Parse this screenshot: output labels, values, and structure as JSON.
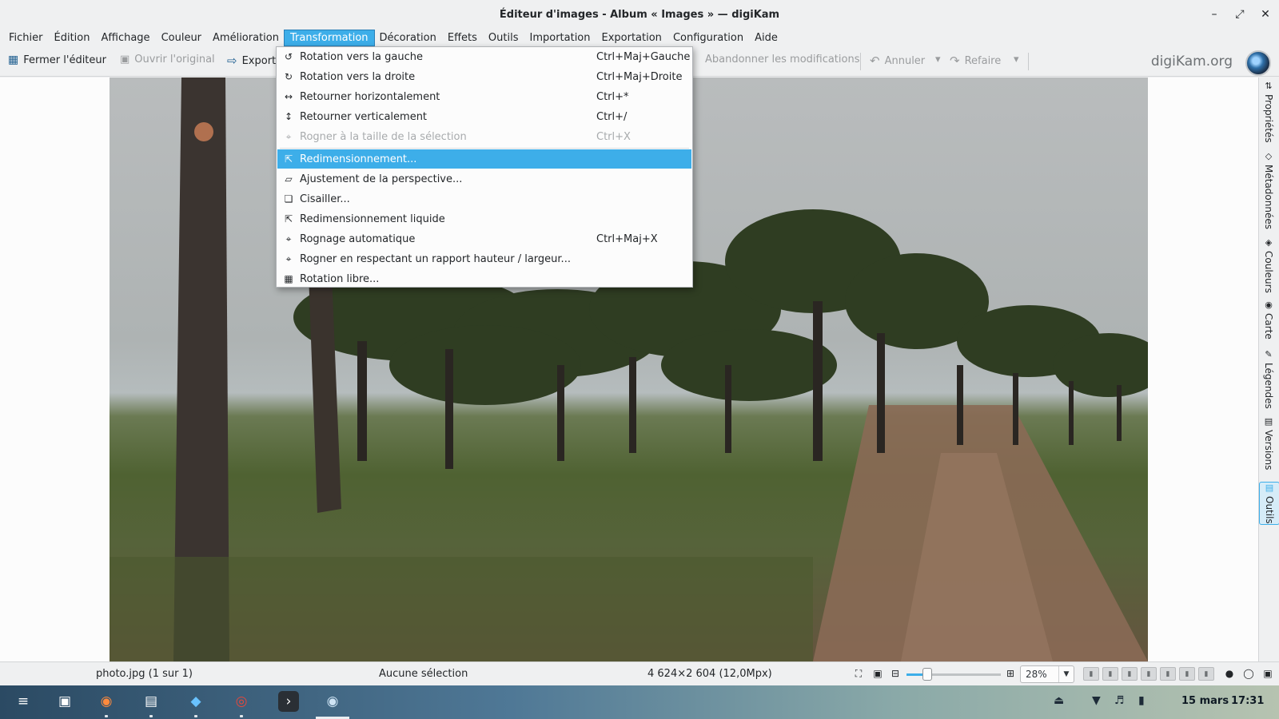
{
  "window": {
    "title": "Éditeur d'images - Album « Images » — digiKam",
    "controls": [
      "minimize-icon",
      "maximize-icon",
      "close-icon"
    ]
  },
  "menubar": {
    "items": [
      "Fichier",
      "Édition",
      "Affichage",
      "Couleur",
      "Amélioration",
      "Transformation",
      "Décoration",
      "Effets",
      "Outils",
      "Importation",
      "Exportation",
      "Configuration",
      "Aide"
    ],
    "active": "Transformation"
  },
  "toolbar": {
    "close_editor": "Fermer l'éditeur",
    "open_original": "Ouvrir l'original",
    "export": "Export",
    "discard": "Abandonner les modifications",
    "undo": "Annuler",
    "redo": "Refaire",
    "logo": "digiKam.org"
  },
  "transform_menu": {
    "items": [
      {
        "label": "Rotation vers la gauche",
        "shortcut": "Ctrl+Maj+Gauche",
        "icon": "rotate-left-icon",
        "enabled": true
      },
      {
        "label": "Rotation vers la droite",
        "shortcut": "Ctrl+Maj+Droite",
        "icon": "rotate-right-icon",
        "enabled": true
      },
      {
        "label": "Retourner horizontalement",
        "shortcut": "Ctrl+*",
        "icon": "flip-horizontal-icon",
        "enabled": true
      },
      {
        "label": "Retourner verticalement",
        "shortcut": "Ctrl+/",
        "icon": "flip-vertical-icon",
        "enabled": true
      },
      {
        "label": "Rogner à la taille de la sélection",
        "shortcut": "Ctrl+X",
        "icon": "crop-icon",
        "enabled": false
      },
      {
        "label": "Redimensionnement...",
        "shortcut": "",
        "icon": "resize-icon",
        "enabled": true,
        "highlighted": true
      },
      {
        "label": "Ajustement de la perspective...",
        "shortcut": "",
        "icon": "perspective-icon",
        "enabled": true
      },
      {
        "label": "Cisailler...",
        "shortcut": "",
        "icon": "shear-icon",
        "enabled": true
      },
      {
        "label": "Redimensionnement liquide",
        "shortcut": "",
        "icon": "liquid-resize-icon",
        "enabled": true
      },
      {
        "label": "Rognage automatique",
        "shortcut": "Ctrl+Maj+X",
        "icon": "auto-crop-icon",
        "enabled": true
      },
      {
        "label": "Rogner en respectant un rapport hauteur / largeur...",
        "shortcut": "",
        "icon": "ratio-crop-icon",
        "enabled": true
      },
      {
        "label": "Rotation libre...",
        "shortcut": "",
        "icon": "free-rotation-icon",
        "enabled": true
      }
    ]
  },
  "right_sidebar": {
    "tabs": [
      {
        "label": "Propriétés",
        "icon": "properties-icon"
      },
      {
        "label": "Métadonnées",
        "icon": "metadata-icon"
      },
      {
        "label": "Couleurs",
        "icon": "colors-icon"
      },
      {
        "label": "Carte",
        "icon": "map-icon"
      },
      {
        "label": "Légendes",
        "icon": "captions-icon"
      },
      {
        "label": "Versions",
        "icon": "versions-icon"
      },
      {
        "label": "Outils",
        "icon": "tools-icon",
        "active": true
      }
    ]
  },
  "statusbar": {
    "file": "photo.jpg (1 sur 1)",
    "selection": "Aucune sélection",
    "dimensions": "4 624×2 604 (12,0Mpx)",
    "zoom": "28%",
    "zoom_slider_fraction": 0.24
  },
  "taskbar": {
    "apps": [
      "zorin-menu-icon",
      "files-window-icon",
      "firefox-icon",
      "file-manager-icon",
      "software-store-icon",
      "chrome-icon",
      "terminal-icon",
      "digikam-icon"
    ],
    "tray": [
      "eject-icon",
      "network-icon",
      "volume-icon",
      "battery-icon"
    ],
    "date": "15 mars",
    "time": "17:31"
  }
}
